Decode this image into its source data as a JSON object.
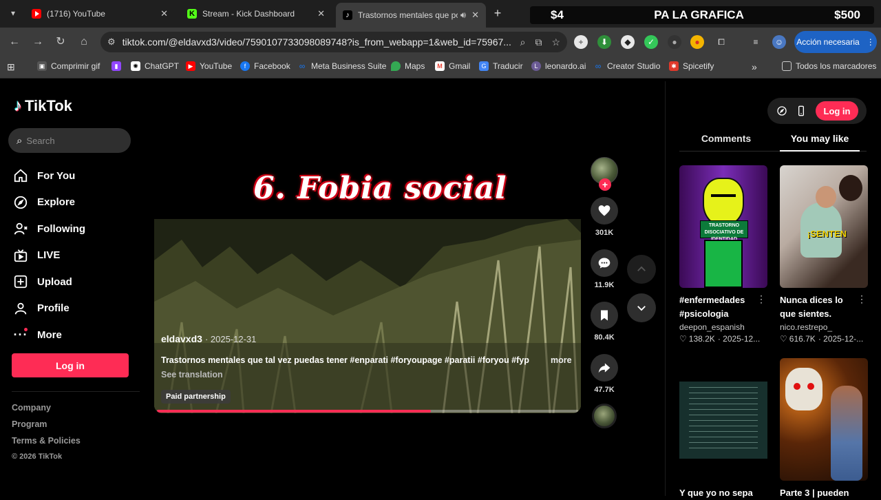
{
  "browser": {
    "tabs": [
      {
        "title": "(1716) YouTube",
        "icon": "youtube-icon"
      },
      {
        "title": "Stream - Kick Dashboard",
        "icon": "kick-icon"
      },
      {
        "title": "Trastornos mentales que po",
        "icon": "tiktok-icon",
        "active": true
      }
    ],
    "banner": {
      "left": "$4",
      "center": "PA LA GRAFICA",
      "right": "$500"
    },
    "url": "tiktok.com/@eldavxd3/video/7590107733098089748?is_from_webapp=1&web_id=75967...",
    "action_button": "Acción necesaria",
    "bookmarks": [
      "Comprimir gif",
      "ChatGPT",
      "YouTube",
      "Facebook",
      "Meta Business Suite",
      "Maps",
      "Gmail",
      "Traducir",
      "leonardo.ai",
      "Creator Studio",
      "Spicetify"
    ],
    "all_bookmarks": "Todos los marcadores"
  },
  "sidebar": {
    "logo": "TikTok",
    "search_placeholder": "Search",
    "nav": [
      {
        "label": "For You",
        "icon": "home-icon"
      },
      {
        "label": "Explore",
        "icon": "compass-icon"
      },
      {
        "label": "Following",
        "icon": "following-icon"
      },
      {
        "label": "LIVE",
        "icon": "live-icon"
      },
      {
        "label": "Upload",
        "icon": "upload-icon"
      },
      {
        "label": "Profile",
        "icon": "profile-icon"
      },
      {
        "label": "More",
        "icon": "more-icon"
      }
    ],
    "login": "Log in",
    "footer": [
      "Company",
      "Program",
      "Terms & Policies"
    ],
    "copyright": "© 2026 TikTok"
  },
  "video": {
    "overlay_title": "6. Fobia social",
    "author": "eldavxd3",
    "date": "· 2025-12-31",
    "description": "Trastornos mentales que tal vez puedas tener #enparati #foryoupage #paratii #foryou #fyp",
    "more": "more",
    "see_translation": "See translation",
    "paid": "Paid partnership",
    "progress": 0.65
  },
  "actions": {
    "likes": "301K",
    "comments": "11.9K",
    "saves": "80.4K",
    "shares": "47.7K"
  },
  "right_panel": {
    "login": "Log in",
    "tabs": [
      "Comments",
      "You may like"
    ],
    "cards": [
      {
        "title": "#enfermedades #psicologia",
        "author": "deepon_espanish",
        "likes": "138.2K",
        "date": "· 2025-12...",
        "thumb_text": "TRASTORNO DISOCIATIVO DE IDENTIDAD"
      },
      {
        "title": "Nunca dices lo que sientes.",
        "author": "nico.restrepo_",
        "likes": "616.7K",
        "date": "· 2025-12-...",
        "thumb_text": "¡SENTEN"
      },
      {
        "title": "Y que yo no sepa"
      },
      {
        "title": "Parte 3 | pueden"
      }
    ]
  },
  "colors": {
    "accent": "#fe2c55",
    "background": "#000000",
    "chrome": "#3c3c3c"
  }
}
